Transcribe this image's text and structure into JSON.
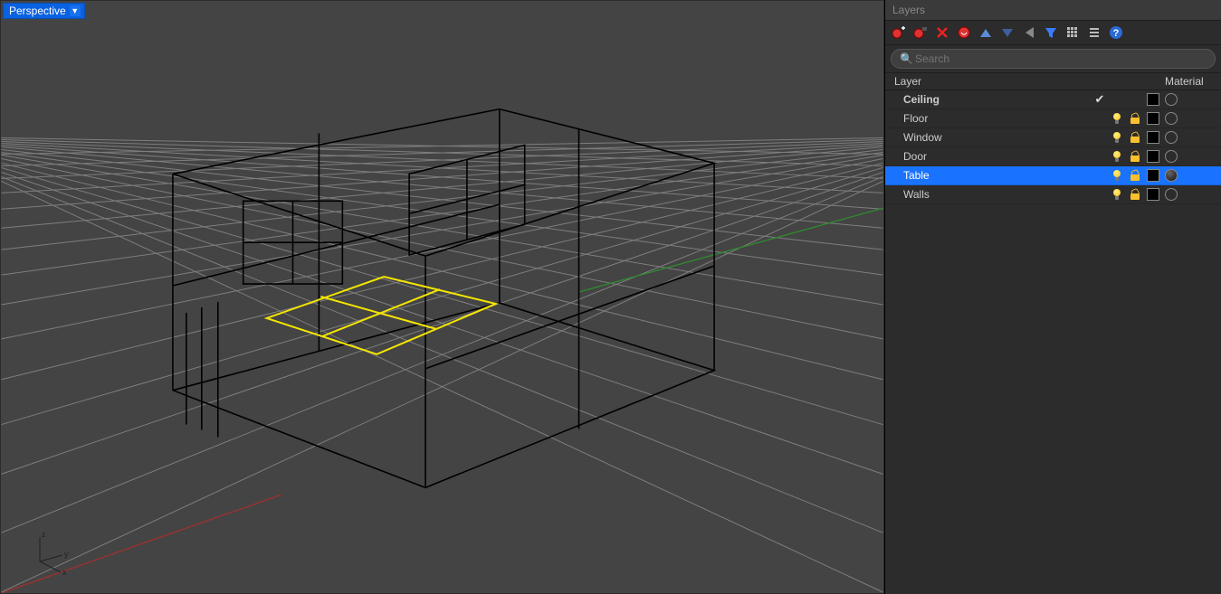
{
  "viewport": {
    "label": "Perspective",
    "axes": {
      "x": "x",
      "y": "y",
      "z": "z"
    }
  },
  "panel": {
    "title": "Layers",
    "search_placeholder": "Search",
    "columns": {
      "layer": "Layer",
      "material": "Material"
    },
    "layers": [
      {
        "name": "Ceiling",
        "current": true,
        "visible": false,
        "locked": false,
        "color": "#000000",
        "material": "empty",
        "selected": false
      },
      {
        "name": "Floor",
        "current": false,
        "visible": true,
        "locked": false,
        "color": "#000000",
        "material": "empty",
        "selected": false
      },
      {
        "name": "Window",
        "current": false,
        "visible": true,
        "locked": false,
        "color": "#000000",
        "material": "empty",
        "selected": false
      },
      {
        "name": "Door",
        "current": false,
        "visible": true,
        "locked": false,
        "color": "#000000",
        "material": "empty",
        "selected": false
      },
      {
        "name": "Table",
        "current": false,
        "visible": true,
        "locked": false,
        "color": "#000000",
        "material": "filled",
        "selected": true
      },
      {
        "name": "Walls",
        "current": false,
        "visible": true,
        "locked": false,
        "color": "#000000",
        "material": "empty",
        "selected": false
      }
    ]
  }
}
